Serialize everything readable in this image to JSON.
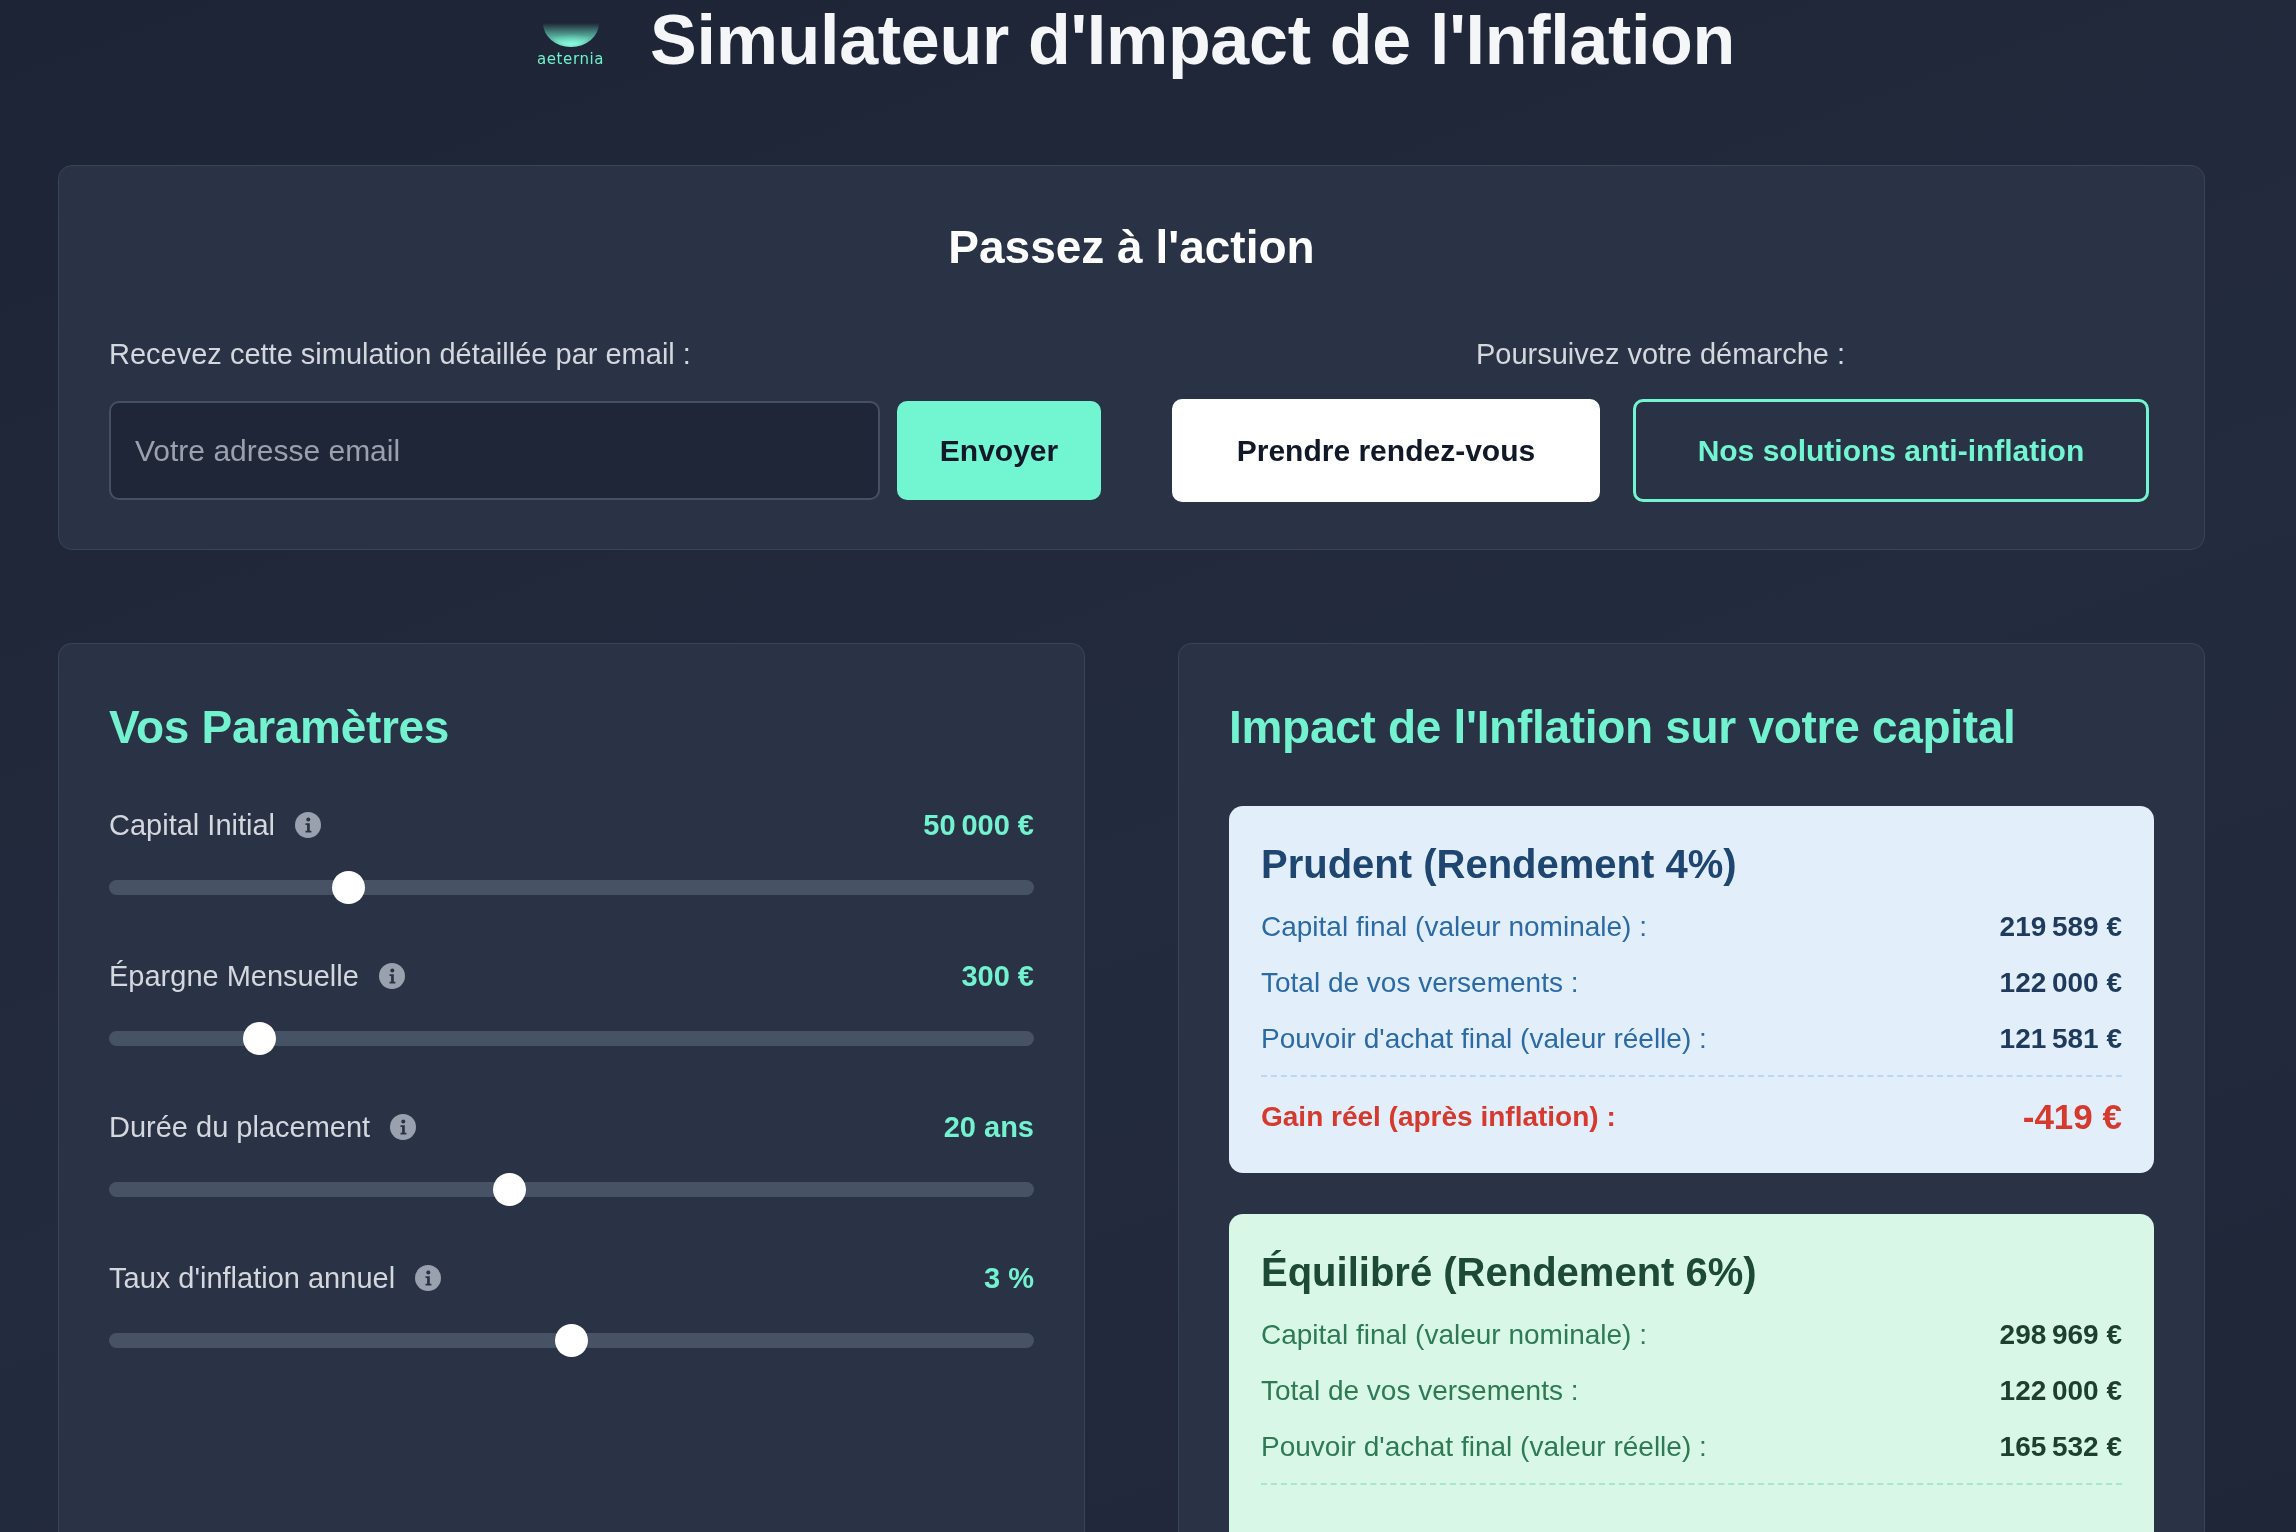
{
  "header": {
    "logo_text": "aeternia",
    "title": "Simulateur d'Impact de l'Inflation"
  },
  "action_panel": {
    "title": "Passez à l'action",
    "email": {
      "label": "Recevez cette simulation détaillée par email :",
      "placeholder": "Votre adresse email",
      "button": "Envoyer"
    },
    "next_steps": {
      "label": "Poursuivez votre démarche :",
      "buttons": [
        {
          "label": "Prendre rendez-vous",
          "kind": "solid"
        },
        {
          "label": "Nos solutions anti-inflation",
          "kind": "outline"
        }
      ]
    }
  },
  "parameters": {
    "title": "Vos Paramètres",
    "sliders": [
      {
        "label": "Capital Initial",
        "value": "50 000 €",
        "level": 0.25
      },
      {
        "label": "Épargne Mensuelle",
        "value": "300 €",
        "level": 0.15
      },
      {
        "label": "Durée du placement",
        "value": "20 ans",
        "level": 0.43
      },
      {
        "label": "Taux d'inflation annuel",
        "value": "3 %",
        "level": 0.5
      }
    ]
  },
  "results": {
    "title": "Impact de l'Inflation sur votre capital",
    "scenarios": [
      {
        "kind": "prudent",
        "title": "Prudent (Rendement 4%)",
        "lines": [
          {
            "kind": "amount",
            "label": "Capital final (valeur nominale) :",
            "value": "219 589 €"
          },
          {
            "kind": "amount",
            "label": "Total de vos versements :",
            "value": "122 000 €"
          },
          {
            "kind": "amount",
            "label": "Pouvoir d'achat final (valeur réelle) :",
            "value": "121 581 €"
          },
          {
            "kind": "divider"
          },
          {
            "kind": "gain",
            "label": "Gain réel (après inflation) :",
            "value": "-419 €"
          }
        ]
      },
      {
        "kind": "balanced",
        "title": "Équilibré (Rendement 6%)",
        "lines": [
          {
            "kind": "amount",
            "label": "Capital final (valeur nominale) :",
            "value": "298 969 €"
          },
          {
            "kind": "amount",
            "label": "Total de vos versements :",
            "value": "122 000 €"
          },
          {
            "kind": "amount",
            "label": "Pouvoir d'achat final (valeur réelle) :",
            "value": "165 532 €"
          },
          {
            "kind": "divider"
          }
        ]
      }
    ]
  }
}
